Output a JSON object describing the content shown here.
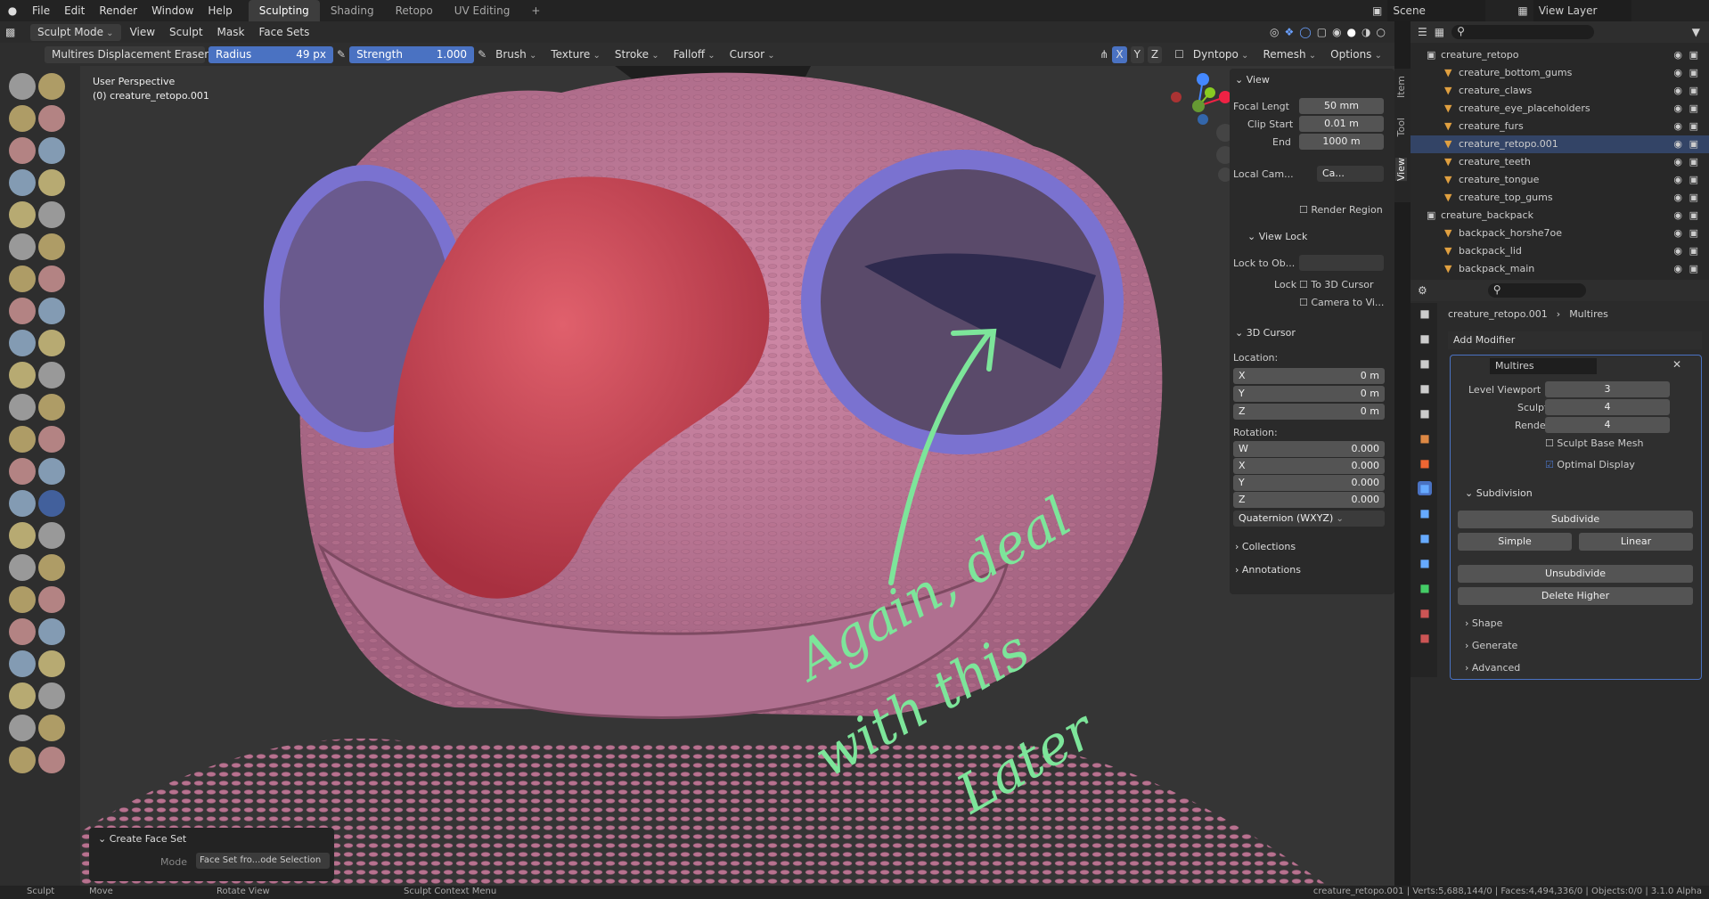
{
  "topbar": {
    "menus": [
      "File",
      "Edit",
      "Render",
      "Window",
      "Help"
    ],
    "workspaces": [
      "Sculpting",
      "Shading",
      "Retopo",
      "UV Editing"
    ],
    "add": "+",
    "scene": "Scene",
    "view_layer": "View Layer"
  },
  "header": {
    "mode": "Sculpt Mode",
    "menus": [
      "View",
      "Sculpt",
      "Mask",
      "Face Sets"
    ]
  },
  "tool_header": {
    "brush_name": "Multires Displacement Eraser",
    "radius_label": "Radius",
    "radius_value": "49 px",
    "strength_label": "Strength",
    "strength_value": "1.000",
    "menus": [
      "Brush",
      "Texture",
      "Stroke",
      "Falloff",
      "Cursor"
    ],
    "axes": [
      "X",
      "Y",
      "Z"
    ],
    "right": [
      "Dyntopo",
      "Remesh",
      "Options"
    ]
  },
  "viewport": {
    "perspective": "User Perspective",
    "object": "(0) creature_retopo.001",
    "annotation": [
      "Again, deal",
      "with this",
      "Later"
    ]
  },
  "npanel": {
    "tabs": [
      "Item",
      "Tool",
      "View"
    ],
    "view": {
      "title": "View",
      "focal_label": "Focal Lengt",
      "focal_value": "50 mm",
      "clip_start_label": "Clip Start",
      "clip_start_value": "0.01 m",
      "end_label": "End",
      "end_value": "1000 m",
      "local_cam_label": "Local Cam...",
      "local_cam_value": "Ca...",
      "render_region": "Render Region"
    },
    "view_lock": {
      "title": "View Lock",
      "lock_to_obj": "Lock to Ob...",
      "lock_label": "Lock",
      "to_cursor": "To 3D Cursor",
      "camera_to_view": "Camera to Vi..."
    },
    "cursor": {
      "title": "3D Cursor",
      "location": "Location:",
      "loc": [
        {
          "axis": "X",
          "value": "0 m"
        },
        {
          "axis": "Y",
          "value": "0 m"
        },
        {
          "axis": "Z",
          "value": "0 m"
        }
      ],
      "rotation": "Rotation:",
      "rot": [
        {
          "axis": "W",
          "value": "0.000"
        },
        {
          "axis": "X",
          "value": "0.000"
        },
        {
          "axis": "Y",
          "value": "0.000"
        },
        {
          "axis": "Z",
          "value": "0.000"
        }
      ],
      "mode": "Quaternion (WXYZ)"
    },
    "collections": "Collections",
    "annotations": "Annotations"
  },
  "outliner": {
    "rows": [
      {
        "name": "creature_retopo",
        "type": "collection"
      },
      {
        "name": "creature_bottom_gums",
        "type": "object"
      },
      {
        "name": "creature_claws",
        "type": "object"
      },
      {
        "name": "creature_eye_placeholders",
        "type": "object"
      },
      {
        "name": "creature_furs",
        "type": "object"
      },
      {
        "name": "creature_retopo.001",
        "type": "object"
      },
      {
        "name": "creature_teeth",
        "type": "object"
      },
      {
        "name": "creature_tongue",
        "type": "object"
      },
      {
        "name": "creature_top_gums",
        "type": "object"
      },
      {
        "name": "creature_backpack",
        "type": "collection"
      },
      {
        "name": "backpack_horshe7oe",
        "type": "object"
      },
      {
        "name": "backpack_lid",
        "type": "object"
      },
      {
        "name": "backpack_main",
        "type": "object"
      }
    ]
  },
  "properties": {
    "breadcrumb_object": "creature_retopo.001",
    "breadcrumb_modifier": "Multires",
    "add_modifier": "Add Modifier",
    "modifier_name": "Multires",
    "level_viewport_label": "Level Viewport",
    "level_viewport": "3",
    "sculpt_label": "Sculpt",
    "sculpt": "4",
    "render_label": "Render",
    "render": "4",
    "sculpt_base_mesh": "Sculpt Base Mesh",
    "optimal_display": "Optimal Display",
    "subdivision": "Subdivision",
    "subdivide": "Subdivide",
    "simple": "Simple",
    "linear": "Linear",
    "unsubdivide": "Unsubdivide",
    "delete_higher": "Delete Higher",
    "shape": "Shape",
    "generate": "Generate",
    "advanced": "Advanced"
  },
  "operator_panel": {
    "title": "Create Face Set",
    "mode_label": "Mode",
    "mode_value": "Face Set fro...ode Selection"
  },
  "status": {
    "left": [
      "Sculpt",
      "Move",
      "Rotate View",
      "Sculpt Context Menu"
    ],
    "right": "creature_retopo.001 | Verts:5,688,144/0 | Faces:4,494,336/0 | Objects:0/0 | 3.1.0 Alpha"
  },
  "colors": {
    "accent": "#4a72c2",
    "skin": "#c27a9a",
    "nose": "#c8404e",
    "eye_ring": "#7a72d0",
    "annotation": "#7de59a"
  }
}
